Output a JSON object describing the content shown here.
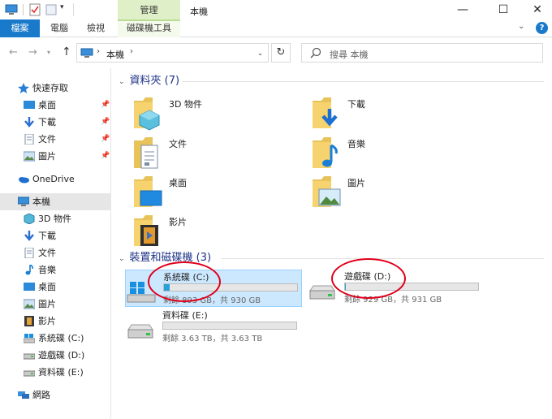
{
  "titlebar": {
    "context_tab_group": "管理",
    "window_title": "本機",
    "minimize": "—",
    "maximize": "☐",
    "close": "✕"
  },
  "ribbon": {
    "tabs": [
      {
        "label": "檔案"
      },
      {
        "label": "電腦"
      },
      {
        "label": "檢視"
      },
      {
        "label": "磁碟機工具"
      }
    ],
    "help": "?"
  },
  "nav": {
    "address_path": "本機",
    "search_placeholder": "搜尋 本機"
  },
  "sidebar": {
    "items": [
      {
        "label": "快速存取"
      },
      {
        "label": "桌面"
      },
      {
        "label": "下載"
      },
      {
        "label": "文件"
      },
      {
        "label": "圖片"
      },
      {
        "label": "OneDrive"
      },
      {
        "label": "本機"
      },
      {
        "label": "3D 物件"
      },
      {
        "label": "下載"
      },
      {
        "label": "文件"
      },
      {
        "label": "音樂"
      },
      {
        "label": "桌面"
      },
      {
        "label": "圖片"
      },
      {
        "label": "影片"
      },
      {
        "label": "系統碟 (C:)"
      },
      {
        "label": "遊戲碟 (D:)"
      },
      {
        "label": "資料碟 (E:)"
      },
      {
        "label": "網路"
      }
    ]
  },
  "main": {
    "folders_header": "資料夾 (7)",
    "folders": [
      {
        "label": "3D 物件"
      },
      {
        "label": "下載"
      },
      {
        "label": "文件"
      },
      {
        "label": "音樂"
      },
      {
        "label": "桌面"
      },
      {
        "label": "圖片"
      },
      {
        "label": "影片"
      }
    ],
    "drives_header": "裝置和磁碟機 (3)",
    "drives": [
      {
        "name": "系統碟 (C:)",
        "stats": "剩餘 893 GB，共 930 GB",
        "used_fraction": 0.04
      },
      {
        "name": "遊戲碟 (D:)",
        "stats": "剩餘 929 GB，共 931 GB",
        "used_fraction": 0.002
      },
      {
        "name": "資料碟 (E:)",
        "stats": "剩餘 3.63 TB，共 3.63 TB",
        "used_fraction": 0.0
      }
    ]
  },
  "colors": {
    "accent": "#1979ca",
    "header_text": "#1e3287",
    "drive_fill": "#26a0da",
    "selection": "#cce8ff",
    "annotation": "#e0001b"
  }
}
